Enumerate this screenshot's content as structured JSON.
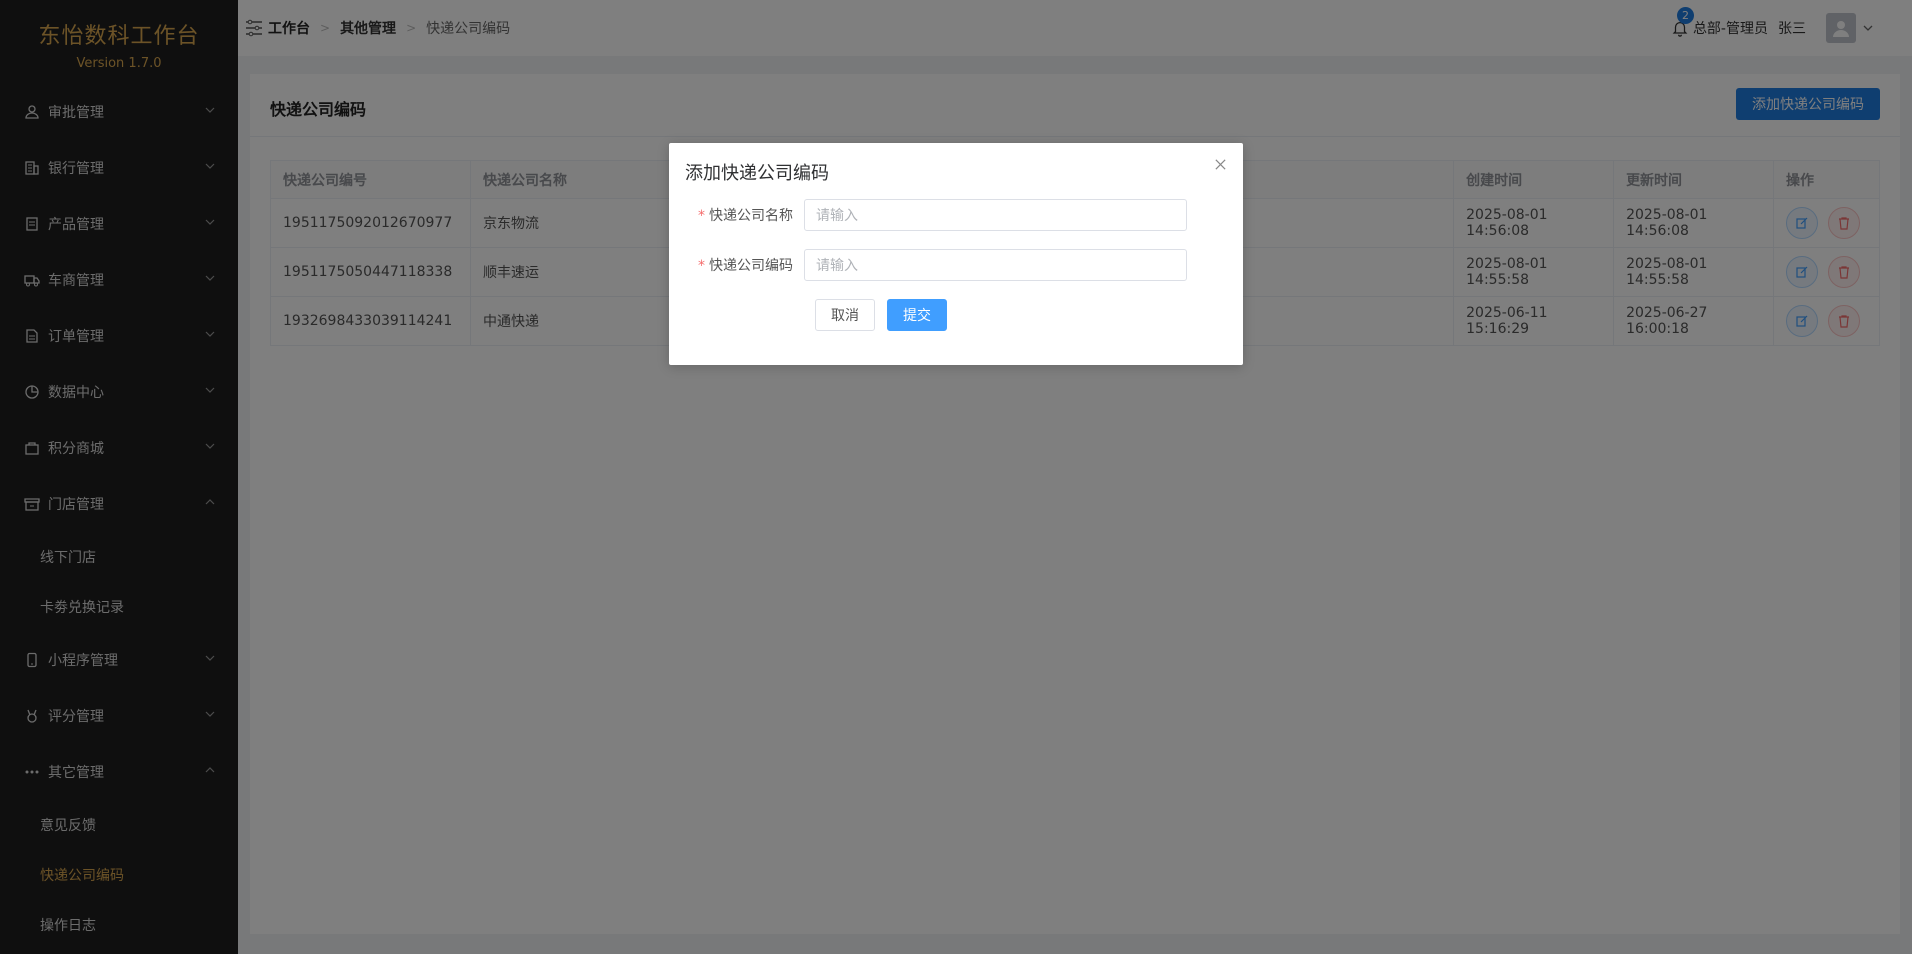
{
  "brand": {
    "title": "东怡数科工作台",
    "version": "Version 1.7.0"
  },
  "sidebar": {
    "items": [
      {
        "label": "审批管理",
        "icon": "user-icon",
        "expanded": false
      },
      {
        "label": "银行管理",
        "icon": "bank-icon",
        "expanded": false
      },
      {
        "label": "产品管理",
        "icon": "document-icon",
        "expanded": false
      },
      {
        "label": "车商管理",
        "icon": "truck-icon",
        "expanded": false
      },
      {
        "label": "订单管理",
        "icon": "order-icon",
        "expanded": false
      },
      {
        "label": "数据中心",
        "icon": "pie-chart-icon",
        "expanded": false
      },
      {
        "label": "积分商城",
        "icon": "shopping-bag-icon",
        "expanded": false
      },
      {
        "label": "门店管理",
        "icon": "store-icon",
        "expanded": true,
        "children": [
          "线下门店",
          "卡劵兑换记录"
        ]
      },
      {
        "label": "小程序管理",
        "icon": "mobile-icon",
        "expanded": false
      },
      {
        "label": "评分管理",
        "icon": "medal-icon",
        "expanded": false
      },
      {
        "label": "其它管理",
        "icon": "more-icon",
        "expanded": true,
        "children": [
          "意见反馈",
          "快递公司编码",
          "操作日志"
        ]
      }
    ],
    "active": "快递公司编码"
  },
  "header": {
    "breadcrumb": [
      "工作台",
      "其他管理",
      "快递公司编码"
    ],
    "notifications": "2",
    "user_role": "总部-管理员",
    "user_name": "张三"
  },
  "page": {
    "title": "快递公司编码",
    "add_button": "添加快递公司编码",
    "table": {
      "headers": [
        "快递公司编号",
        "快递公司名称",
        "",
        "创建时间",
        "更新时间",
        "操作"
      ],
      "rows": [
        [
          "1951175092012670977",
          "京东物流",
          "",
          "2025-08-01 14:56:08",
          "2025-08-01 14:56:08"
        ],
        [
          "1951175050447118338",
          "顺丰速运",
          "",
          "2025-08-01 14:55:58",
          "2025-08-01 14:55:58"
        ],
        [
          "1932698433039114241",
          "中通快递",
          "",
          "2025-06-11 15:16:29",
          "2025-06-27 16:00:18"
        ]
      ]
    }
  },
  "dialog": {
    "title": "添加快递公司编码",
    "fields": [
      {
        "label": "快递公司名称",
        "placeholder": "请输入",
        "value": ""
      },
      {
        "label": "快递公司编码",
        "placeholder": "请输入",
        "value": ""
      }
    ],
    "required_mark": "*",
    "cancel": "取消",
    "submit": "提交"
  },
  "colors": {
    "accent": "#409eff",
    "brand": "#d9a74f",
    "sidebar_bg": "#1f1f1f",
    "danger": "#f56c6c"
  }
}
